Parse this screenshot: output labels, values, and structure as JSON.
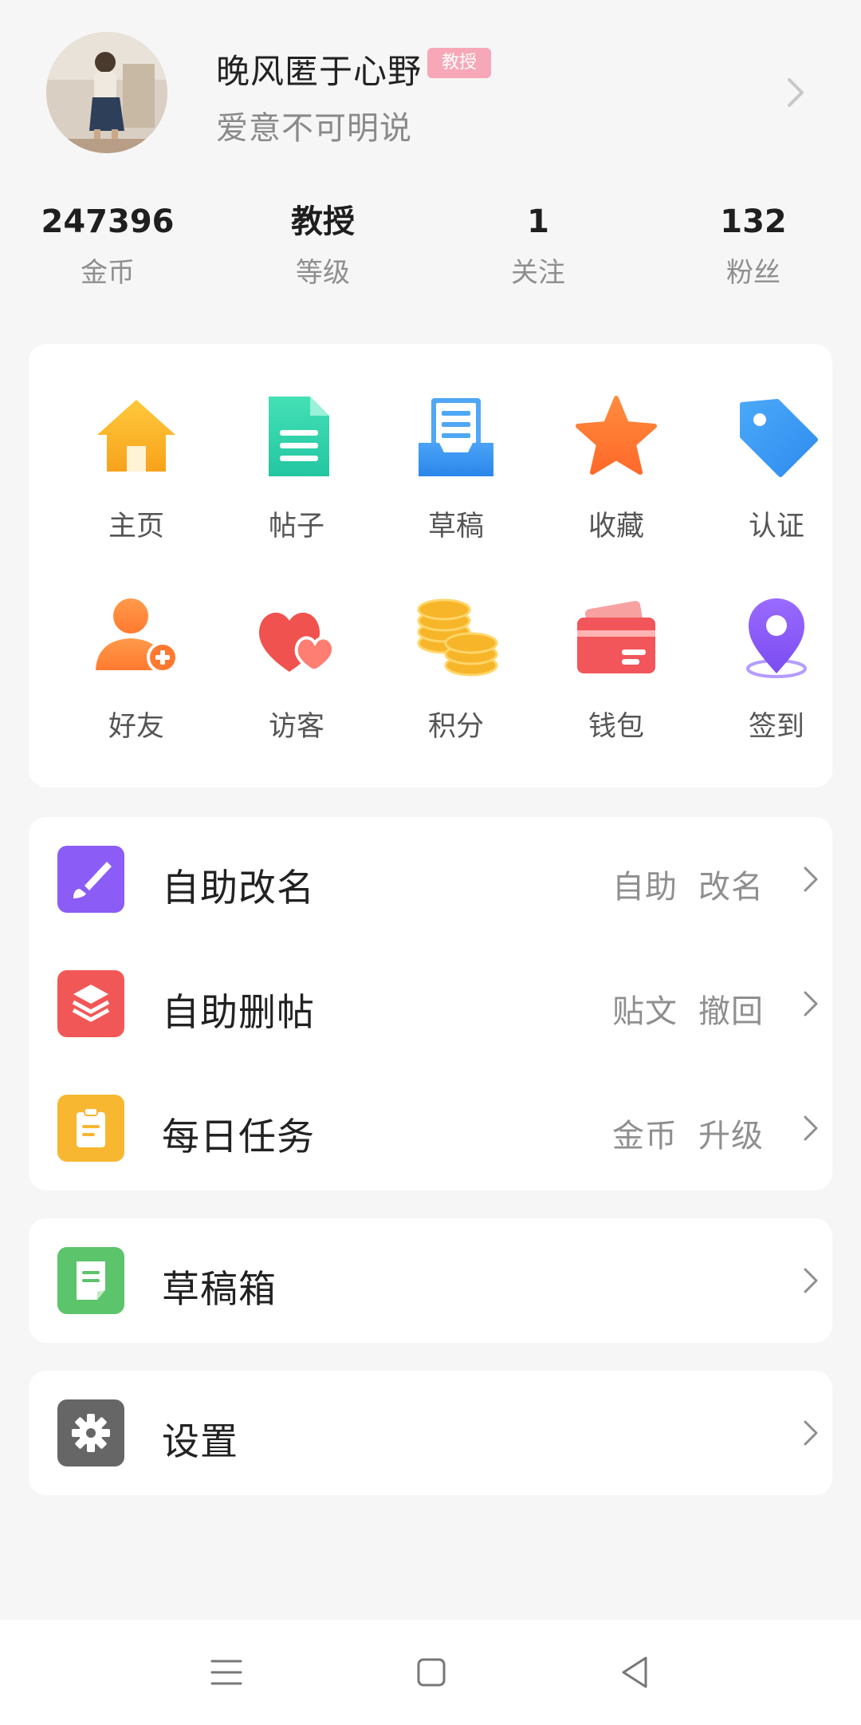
{
  "profile": {
    "username": "晚风匿于心野",
    "badge": "教授",
    "bio": "爱意不可明说"
  },
  "stats": [
    {
      "value": "247396",
      "label": "金币"
    },
    {
      "value": "教授",
      "label": "等级"
    },
    {
      "value": "1",
      "label": "关注"
    },
    {
      "value": "132",
      "label": "粉丝"
    }
  ],
  "grid": [
    {
      "label": "主页",
      "icon": "home-icon"
    },
    {
      "label": "帖子",
      "icon": "document-icon"
    },
    {
      "label": "草稿",
      "icon": "draft-tray-icon"
    },
    {
      "label": "收藏",
      "icon": "star-icon"
    },
    {
      "label": "认证",
      "icon": "tag-icon"
    },
    {
      "label": "好友",
      "icon": "add-friend-icon"
    },
    {
      "label": "访客",
      "icon": "hearts-icon"
    },
    {
      "label": "积分",
      "icon": "coins-icon"
    },
    {
      "label": "钱包",
      "icon": "wallet-icon"
    },
    {
      "label": "签到",
      "icon": "location-pin-icon"
    }
  ],
  "services": [
    {
      "title": "自助改名",
      "meta": [
        "自助",
        "改名"
      ],
      "icon": "brush-icon",
      "color": "#8b5cf6"
    },
    {
      "title": "自助删帖",
      "meta": [
        "贴文",
        "撤回"
      ],
      "icon": "layers-icon",
      "color": "#f25757"
    },
    {
      "title": "每日任务",
      "meta": [
        "金币",
        "升级"
      ],
      "icon": "clipboard-icon",
      "color": "#f7b731"
    }
  ],
  "drafts": {
    "title": "草稿箱",
    "icon": "note-icon",
    "color": "#5cc46a"
  },
  "settings": {
    "title": "设置",
    "icon": "gear-icon",
    "color": "#666666"
  },
  "nav": [
    "menu-icon",
    "home-square-icon",
    "back-triangle-icon"
  ]
}
